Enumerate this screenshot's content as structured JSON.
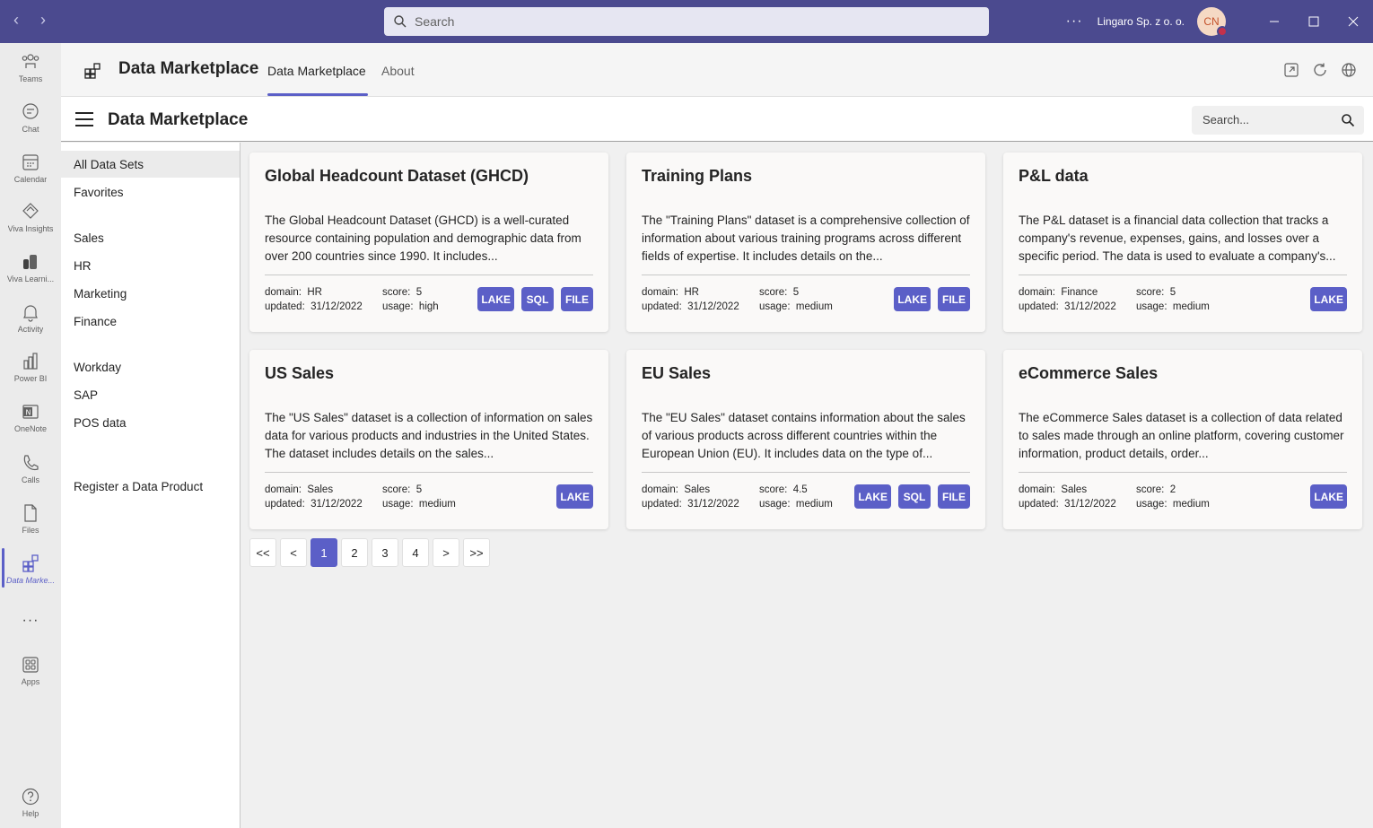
{
  "titlebar": {
    "search_placeholder": "Search",
    "more": "···",
    "org": "Lingaro Sp. z o. o.",
    "avatar_initials": "CN"
  },
  "rail": {
    "items": [
      {
        "label": "Teams",
        "icon": "teams-icon"
      },
      {
        "label": "Chat",
        "icon": "chat-icon"
      },
      {
        "label": "Calendar",
        "icon": "calendar-icon"
      },
      {
        "label": "Viva Insights",
        "icon": "viva-insights-icon"
      },
      {
        "label": "Viva Learni...",
        "icon": "viva-learning-icon"
      },
      {
        "label": "Activity",
        "icon": "bell-icon"
      },
      {
        "label": "Power BI",
        "icon": "power-bi-icon"
      },
      {
        "label": "OneNote",
        "icon": "onenote-icon"
      },
      {
        "label": "Calls",
        "icon": "phone-icon"
      },
      {
        "label": "Files",
        "icon": "file-icon"
      },
      {
        "label": "Data Marke...",
        "icon": "data-marketplace-icon"
      },
      {
        "label": "···",
        "icon": "more-icon"
      },
      {
        "label": "Apps",
        "icon": "apps-icon"
      },
      {
        "label": "Help",
        "icon": "help-icon"
      }
    ]
  },
  "app": {
    "title": "Data Marketplace",
    "tabs": [
      {
        "label": "Data Marketplace",
        "active": true
      },
      {
        "label": "About",
        "active": false
      }
    ]
  },
  "page": {
    "title": "Data Marketplace",
    "search_placeholder": "Search..."
  },
  "sidebar": {
    "items": [
      {
        "label": "All Data Sets",
        "active": true
      },
      {
        "label": "Favorites"
      },
      {
        "label": "Sales"
      },
      {
        "label": "HR"
      },
      {
        "label": "Marketing"
      },
      {
        "label": "Finance"
      },
      {
        "label": "Workday"
      },
      {
        "label": "SAP"
      },
      {
        "label": "POS data"
      },
      {
        "label": "Register a Data Product"
      }
    ]
  },
  "labels": {
    "domain": "domain:",
    "updated": "updated:",
    "score": "score:",
    "usage": "usage:"
  },
  "cards": [
    {
      "title": "Global Headcount Dataset (GHCD)",
      "description": "The Global Headcount Dataset (GHCD) is a well-curated resource containing population and demographic data from over 200 countries since 1990. It includes...",
      "domain": "HR",
      "updated": "31/12/2022",
      "score": "5",
      "usage": "high",
      "badges": [
        "LAKE",
        "SQL",
        "FILE"
      ]
    },
    {
      "title": "Training Plans",
      "description": "The \"Training Plans\" dataset is a comprehensive collection of information about various training programs across different fields of expertise. It includes details on the...",
      "domain": "HR",
      "updated": "31/12/2022",
      "score": "5",
      "usage": "medium",
      "badges": [
        "LAKE",
        "FILE"
      ]
    },
    {
      "title": "P&L data",
      "description": "The P&L dataset is a financial data collection that tracks a company's revenue, expenses, gains, and losses over a specific period. The data is used to evaluate a company's...",
      "domain": "Finance",
      "updated": "31/12/2022",
      "score": "5",
      "usage": "medium",
      "badges": [
        "LAKE"
      ]
    },
    {
      "title": "US Sales",
      "description": "The \"US Sales\" dataset is a collection of information on sales data for various products and industries in the United States. The dataset includes details on the sales...",
      "domain": "Sales",
      "updated": "31/12/2022",
      "score": "5",
      "usage": "medium",
      "badges": [
        "LAKE"
      ]
    },
    {
      "title": "EU Sales",
      "description": "The \"EU Sales\" dataset contains information about the sales of various products across different countries within the European Union (EU). It includes data on the type of...",
      "domain": "Sales",
      "updated": "31/12/2022",
      "score": "4.5",
      "usage": "medium",
      "badges": [
        "LAKE",
        "SQL",
        "FILE"
      ]
    },
    {
      "title": "eCommerce Sales",
      "description": "The eCommerce Sales dataset is a collection of data related to sales made through an online platform, covering customer information, product details, order...",
      "domain": "Sales",
      "updated": "31/12/2022",
      "score": "2",
      "usage": "medium",
      "badges": [
        "LAKE"
      ]
    }
  ],
  "pagination": {
    "buttons": [
      "<<",
      "<",
      "1",
      "2",
      "3",
      "4",
      ">",
      ">>"
    ],
    "current": "1"
  },
  "colors": {
    "accent": "#5b5fc7",
    "titlebar": "#4b4a8f"
  }
}
